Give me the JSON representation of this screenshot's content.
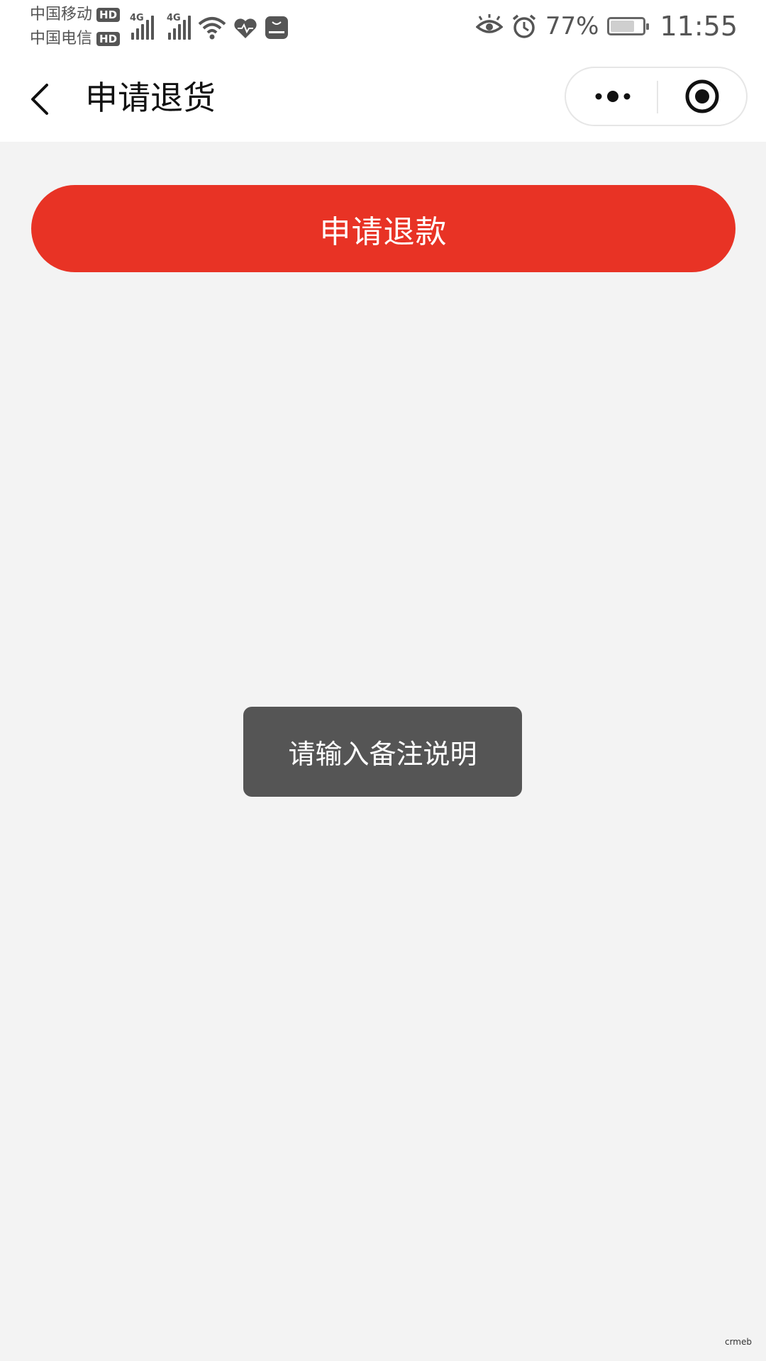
{
  "status_bar": {
    "carrier_1": "中国移动",
    "carrier_2": "中国电信",
    "hd_badge": "HD",
    "network_1": "4G",
    "network_2": "4G",
    "battery_percent": "77%",
    "battery_level": 0.77,
    "time": "11:55",
    "icons": [
      "eye-icon",
      "alarm-icon",
      "wifi-icon",
      "health-icon",
      "huawei-app-icon"
    ]
  },
  "nav_bar": {
    "title": "申请退货"
  },
  "main": {
    "refund_button_label": "申请退款",
    "accent_color": "#e83325"
  },
  "toast": {
    "message": "请输入备注说明"
  },
  "watermark": "crmeb"
}
